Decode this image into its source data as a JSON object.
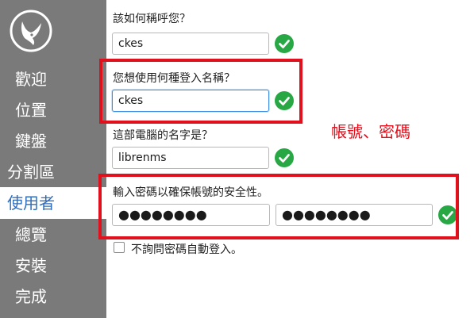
{
  "sidebar": {
    "items": [
      {
        "label": "歡迎",
        "active": false
      },
      {
        "label": "位置",
        "active": false
      },
      {
        "label": "鍵盤",
        "active": false
      },
      {
        "label": "分割區",
        "active": false
      },
      {
        "label": "使用者",
        "active": true
      },
      {
        "label": "總覽",
        "active": false
      },
      {
        "label": "安裝",
        "active": false
      },
      {
        "label": "完成",
        "active": false
      }
    ],
    "logo_icon": "distro-logo-icon"
  },
  "form": {
    "fullname_label": "該如何稱呼您？",
    "fullname_value": "ckes",
    "username_label": "您想使用何種登入名稱？",
    "username_value": "ckes",
    "hostname_label": "這部電腦的名字是？",
    "hostname_value": "librenms",
    "password_label": "輸入密碼以確保帳號的安全性。",
    "password_value": "●●●●●●●●",
    "password_confirm_value": "●●●●●●●●",
    "autologin_label": "不詢問密碼自動登入。",
    "autologin_checked": false,
    "valid_icon": "green-check-icon"
  },
  "annotation": {
    "text": "帳號、密碼",
    "color": "#e0101c"
  },
  "colors": {
    "sidebar_bg": "#7a7a7a",
    "active_text": "#2f6ebd",
    "check_green": "#27a844"
  }
}
